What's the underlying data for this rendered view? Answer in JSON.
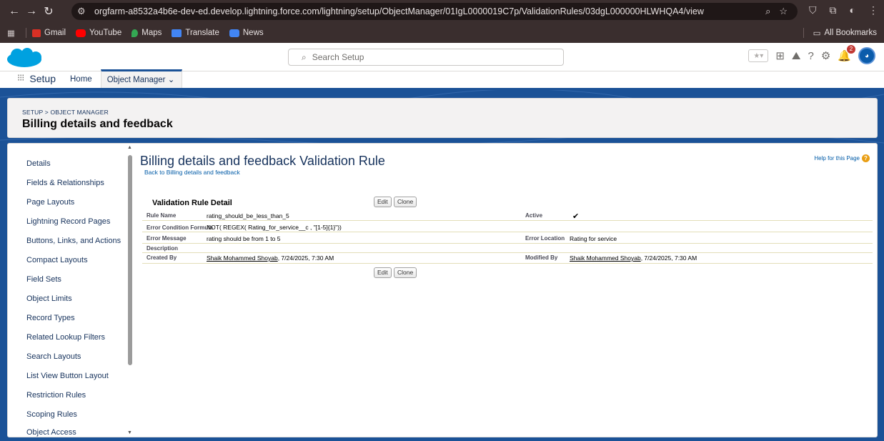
{
  "browser": {
    "url": "orgfarm-a8532a4b6e-dev-ed.develop.lightning.force.com/lightning/setup/ObjectManager/01IgL0000019C7p/ValidationRules/03dgL000000HLWHQA4/view",
    "bookmarks": [
      "Gmail",
      "YouTube",
      "Maps",
      "Translate",
      "News"
    ],
    "all_bookmarks": "All Bookmarks"
  },
  "header": {
    "search_placeholder": "Search Setup",
    "notification_count": "2"
  },
  "nav": {
    "app_name": "Setup",
    "home": "Home",
    "object_manager": "Object Manager"
  },
  "page": {
    "breadcrumb": "SETUP > OBJECT MANAGER",
    "title": "Billing details and feedback"
  },
  "sidebar": {
    "items": [
      "Details",
      "Fields & Relationships",
      "Page Layouts",
      "Lightning Record Pages",
      "Buttons, Links, and Actions",
      "Compact Layouts",
      "Field Sets",
      "Object Limits",
      "Record Types",
      "Related Lookup Filters",
      "Search Layouts",
      "List View Button Layout",
      "Restriction Rules",
      "Scoping Rules",
      "Object Access"
    ]
  },
  "detail": {
    "heading": "Billing details and feedback Validation Rule",
    "back_link": "Back to Billing details and feedback",
    "help_link": "Help for this Page",
    "section_title": "Validation Rule Detail",
    "edit_label": "Edit",
    "clone_label": "Clone",
    "rule_name_label": "Rule Name",
    "rule_name": "rating_should_be_less_than_5",
    "active_label": "Active",
    "active_mark": "✔",
    "formula_label": "Error Condition Formula",
    "formula": "NOT( REGEX( Rating_for_service__c , \"[1-5]{1}\"))",
    "error_message_label": "Error Message",
    "error_message": "rating should be from 1 to 5",
    "error_location_label": "Error Location",
    "error_location": "Rating for service",
    "description_label": "Description",
    "created_by_label": "Created By",
    "created_by_name": "Shaik Mohammed Shoyab",
    "created_by_date": ", 7/24/2025, 7:30 AM",
    "modified_by_label": "Modified By",
    "modified_by_name": "Shaik Mohammed Shoyab",
    "modified_by_date": ", 7/24/2025, 7:30 AM"
  },
  "colors": {
    "brand_blue": "#1b5297",
    "link_blue": "#015ba7",
    "chrome_dark": "#3a2e2e"
  }
}
